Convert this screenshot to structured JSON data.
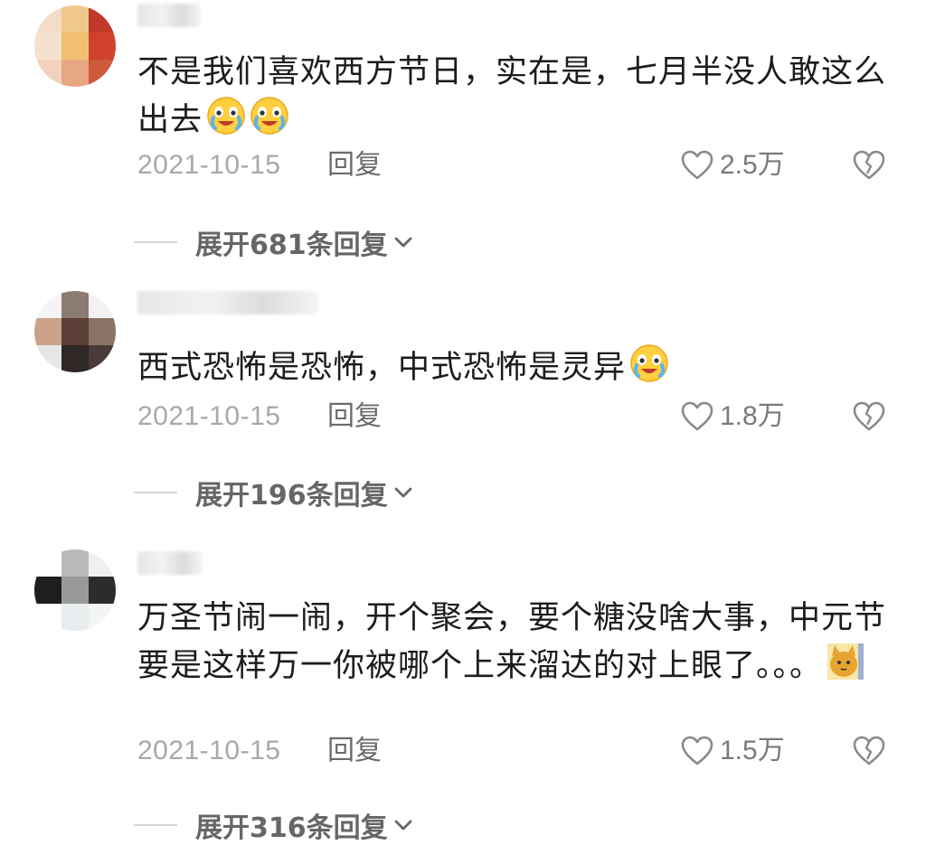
{
  "colors": {
    "text": "#1c1c1c",
    "meta": "#a8a8a8",
    "action": "#6b6b6b",
    "icon_stroke": "#8a8a8a"
  },
  "comments": [
    {
      "text": "不是我们喜欢西方节日，实在是，七月半没人敢这么出去",
      "emojis": [
        "cry-laugh-emoji",
        "cry-laugh-emoji"
      ],
      "date": "2021-10-15",
      "reply_label": "回复",
      "likes": "2.5万",
      "expand_label": "展开681条回复"
    },
    {
      "text": "西式恐怖是恐怖，中式恐怖是灵异",
      "emojis": [
        "cry-laugh-emoji"
      ],
      "date": "2021-10-15",
      "reply_label": "回复",
      "likes": "1.8万",
      "expand_label": "展开196条回复"
    },
    {
      "text": "万圣节闹一闹，开个聚会，要个糖没啥大事，中元节要是这样万一你被哪个上来溜达的对上眼了。。。",
      "emojis": [
        "cat-sticker-emoji"
      ],
      "date": "2021-10-15",
      "reply_label": "回复",
      "likes": "1.5万",
      "expand_label": "展开316条回复"
    }
  ]
}
